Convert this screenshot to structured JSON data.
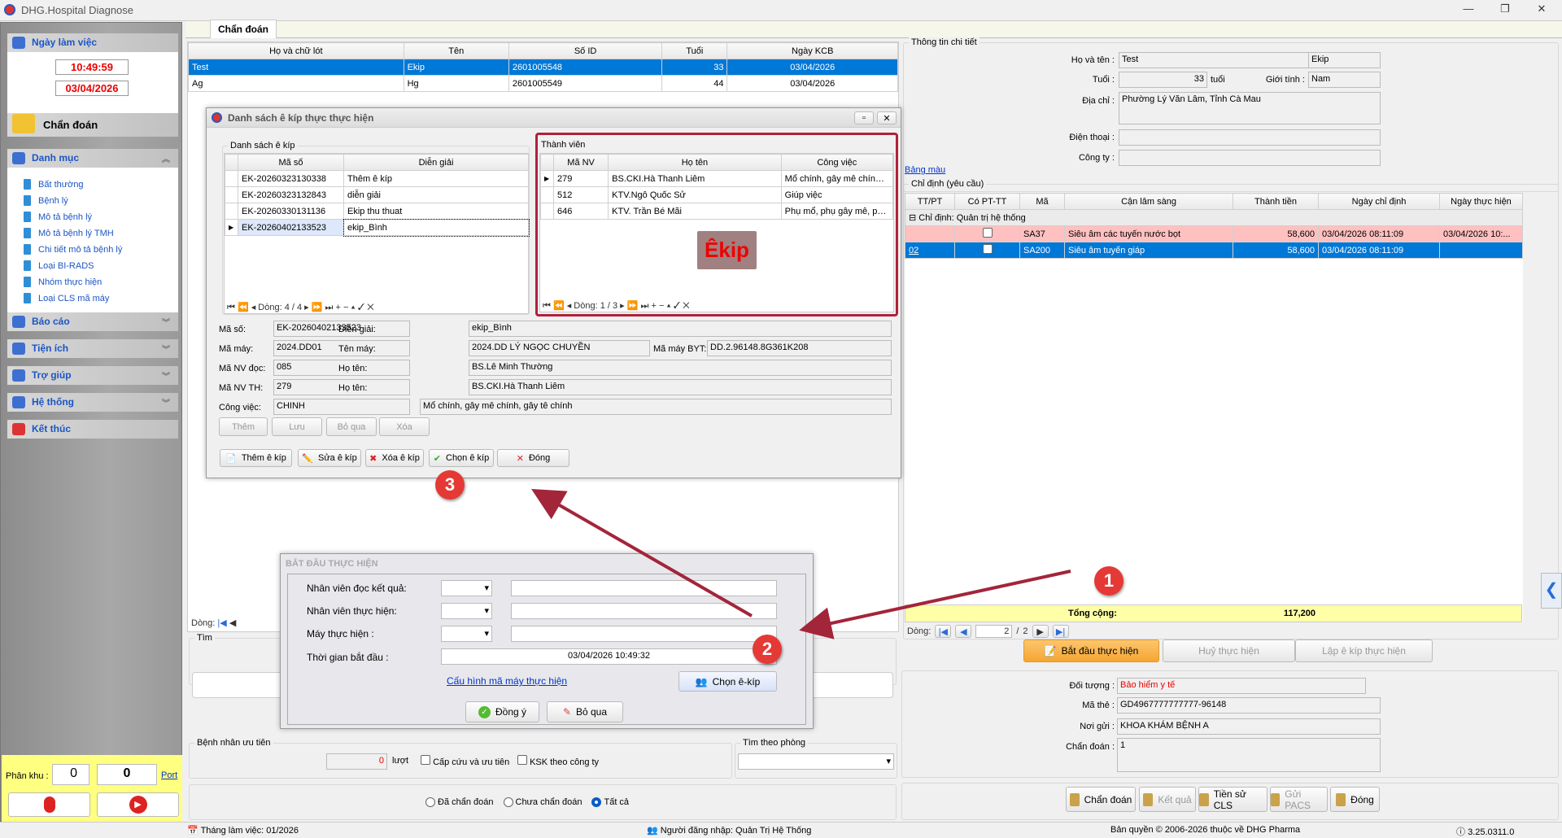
{
  "app": {
    "title": "DHG.Hospital Diagnose"
  },
  "sidebar": {
    "work_day": {
      "label": "Ngày làm việc",
      "time": "10:49:59",
      "date": "03/04/2026"
    },
    "diagnose": "Chẩn đoán",
    "catalog": {
      "label": "Danh mục",
      "items": [
        "Bất thường",
        "Bệnh lý",
        "Mô tả bệnh lý",
        "Mô tả bệnh lý TMH",
        "Chi tiết mô tả bệnh lý",
        "Loại BI-RADS",
        "Nhóm thực hiện",
        "Loại CLS mã máy"
      ]
    },
    "sections": [
      "Báo cáo",
      "Tiện ích",
      "Trợ giúp",
      "Hệ thống",
      "Kết thúc"
    ],
    "zone": {
      "label": "Phân khu :",
      "value1": "0",
      "value2": "0",
      "port": "Port"
    }
  },
  "main": {
    "tab": "Chẩn đoán",
    "patients": {
      "columns": [
        "Họ và chữ lót",
        "Tên",
        "Số ID",
        "Tuổi",
        "Ngày KCB"
      ],
      "rows": [
        [
          "Test",
          "Ekip",
          "2601005548",
          "33",
          "03/04/2026"
        ],
        [
          "Ag",
          "Hg",
          "2601005549",
          "44",
          "03/04/2026"
        ]
      ]
    },
    "nav_label": "Dòng:",
    "search_label": "Tìm",
    "priority": {
      "label": "Bệnh nhân ưu tiên",
      "count": "0",
      "unit": "lượt",
      "emergency": "Cấp cứu và ưu tiên",
      "ksk": "KSK theo công ty"
    },
    "room_search": "Tìm theo phòng",
    "filters": [
      "Đã chẩn đoán",
      "Chưa chẩn đoán",
      "Tất cả"
    ],
    "filter_selected": "Tất cả"
  },
  "ekip_dialog": {
    "title": "Danh sách ê kíp thực thực hiện",
    "list": {
      "label": "Danh sách ê kíp",
      "columns": [
        "Mã số",
        "Diễn giải"
      ],
      "rows": [
        [
          "EK-20260323130338",
          "Thêm ê kíp"
        ],
        [
          "EK-20260323132843",
          "diễn giải"
        ],
        [
          "EK-20260330131136",
          "Ekip thu thuat"
        ],
        [
          "EK-20260402133523",
          "ekip_Bình"
        ]
      ],
      "nav": "Dòng: 4 / 4"
    },
    "members": {
      "label": "Thành viên",
      "columns": [
        "Mã NV",
        "Họ tên",
        "Công việc"
      ],
      "rows": [
        [
          "279",
          "BS.CKI.Hà Thanh Liêm",
          "Mổ chính, gây mê chính,..."
        ],
        [
          "512",
          "KTV.Ngô Quốc Sử",
          "Giúp việc"
        ],
        [
          "646",
          "KTV. Trần Bé Mãi",
          "Phụ mổ, phụ gây mê, ph..."
        ]
      ],
      "nav": "Dòng: 1 / 3",
      "stamp": "Êkip"
    },
    "form": {
      "ma_so_label": "Mã số:",
      "ma_so": "EK-20260402133523",
      "dien_giai_label": "Diễn giải:",
      "dien_giai": "ekip_Bình",
      "ma_may_label": "Mã máy:",
      "ma_may": "2024.DD01",
      "ten_may_label": "Tên máy:",
      "ten_may": "2024.DD LÝ NGỌC CHUYỀN",
      "byt_label": "Mã máy BYT:",
      "byt": "DD.2.96148.8G361K208",
      "nv_doc_label": "Mã NV đọc:",
      "nv_doc": "085",
      "ho_ten_label": "Họ tên:",
      "nv_doc_name": "BS.Lê Minh Thường",
      "nv_th_label": "Mã NV TH:",
      "nv_th": "279",
      "nv_th_name": "BS.CKI.Hà Thanh Liêm",
      "cong_viec_label": "Công việc:",
      "cong_viec": "CHINH",
      "cong_viec_desc": "Mổ chính, gây mê chính, gây tê chính"
    },
    "edit_buttons": [
      "Thêm",
      "Lưu",
      "Bỏ qua",
      "Xóa"
    ],
    "buttons": [
      "Thêm ê kíp",
      "Sửa ê kíp",
      "Xóa  ê kíp",
      "Chọn  ê kíp",
      "Đóng"
    ]
  },
  "start_dialog": {
    "title": "BẮT ĐẦU THỰC HIỆN",
    "reader_label": "Nhân viên đọc kết quả:",
    "performer_label": "Nhân viên thực hiện:",
    "machine_label": "Máy thực hiện :",
    "start_label": "Thời gian bắt đầu :",
    "start_value": "03/04/2026 10:49:32",
    "config_link": "Cấu hình mã máy thực hiện",
    "choose_ekip": "Chọn ê-kíp",
    "ok": "Đồng ý",
    "cancel": "Bỏ qua"
  },
  "detail": {
    "group": "Thông tin chi tiết",
    "name_label": "Họ và tên :",
    "last_name": "Test",
    "first_name": "Ekip",
    "age_label": "Tuổi :",
    "age": "33",
    "age_unit": "tuổi",
    "gender_label": "Giới tính :",
    "gender": "Nam",
    "address_label": "Địa chỉ :",
    "address": "Phường Lý Văn Lâm, Tỉnh Cà Mau",
    "phone_label": "Điện thoại :",
    "phone": "",
    "company_label": "Công ty :",
    "company": "",
    "color_link": "Bảng màu"
  },
  "orders": {
    "group": "Chỉ định (yêu cầu)",
    "columns": [
      "TT/PT",
      "Có PT-TT",
      "Mã",
      "Cận lâm sàng",
      "Thành tiền",
      "Ngày chỉ định",
      "Ngày thực hiện"
    ],
    "group_row": "Chỉ định:  Quản trị hệ thống",
    "rows": [
      [
        "",
        "",
        "SA37",
        "Siêu âm các tuyến nước bọt",
        "58,600",
        "03/04/2026 08:11:09",
        "03/04/2026 10:..."
      ],
      [
        "02",
        "",
        "SA200",
        "Siêu âm tuyến giáp",
        "58,600",
        "03/04/2026 08:11:09",
        ""
      ]
    ],
    "total_label": "Tổng cộng:",
    "total": "117,200",
    "nav_label": "Dòng:",
    "page": "2",
    "pages": "2",
    "actions": [
      "Bắt đầu thực hiện",
      "Huỷ thực hiện",
      "Lập ê kíp thực hiện"
    ]
  },
  "insurance": {
    "object_label": "Đối tượng :",
    "object": "Bảo hiểm y tế",
    "card_label": "Mã thẻ :",
    "card": "GD4967777777777-96148",
    "sender_label": "Nơi gửi :",
    "sender": "KHOA KHÁM BỆNH A",
    "diag_label": "Chẩn đoán :",
    "diag": "1"
  },
  "bottom_buttons": [
    "Chẩn đoán",
    "Kết quả",
    "Tiền sử CLS",
    "Gửi PACS",
    "Đóng"
  ],
  "status": {
    "month": "Tháng làm việc: 01/2026",
    "user": "Người đăng nhập: Quản Trị Hệ Thống",
    "copyright": "Bản quyền © 2006-2026 thuộc về DHG Pharma",
    "version": "3.25.0311.0"
  },
  "annotations": {
    "b1": "1",
    "b2": "2",
    "b3": "3"
  },
  "colors": {
    "accent": "#0078d7",
    "highlight_row": "#ffc0c0",
    "total_row": "#ffffa8",
    "ekip_border": "#b0213a",
    "orange": "#f9b24a"
  }
}
